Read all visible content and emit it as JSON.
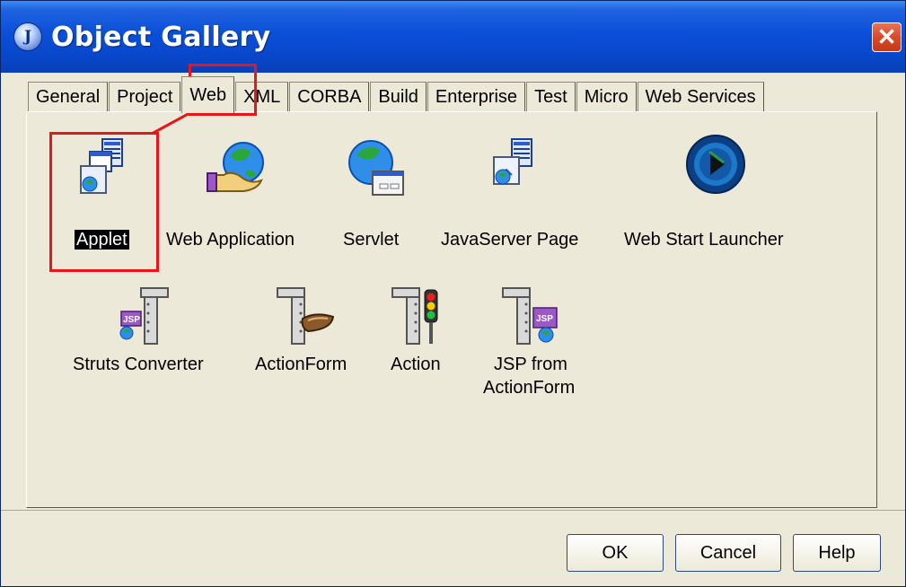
{
  "window": {
    "title": "Object Gallery",
    "title_icon_letter": "J",
    "close_glyph": "✕"
  },
  "tabs": [
    {
      "label": "General"
    },
    {
      "label": "Project"
    },
    {
      "label": "Web"
    },
    {
      "label": "XML"
    },
    {
      "label": "CORBA"
    },
    {
      "label": "Build"
    },
    {
      "label": "Enterprise"
    },
    {
      "label": "Test"
    },
    {
      "label": "Micro"
    },
    {
      "label": "Web Services"
    }
  ],
  "active_tab": "Web",
  "items": [
    {
      "label": "Applet",
      "icon": "applet-icon",
      "selected": true
    },
    {
      "label": "Web Application",
      "icon": "web-application-icon"
    },
    {
      "label": "Servlet",
      "icon": "servlet-icon"
    },
    {
      "label": "JavaServer Page",
      "icon": "javaserver-page-icon"
    },
    {
      "label": "Web Start Launcher",
      "icon": "web-start-launcher-icon"
    },
    {
      "label": "Struts Converter",
      "icon": "struts-converter-icon"
    },
    {
      "label": "ActionForm",
      "icon": "actionform-icon"
    },
    {
      "label": "Action",
      "icon": "action-icon"
    },
    {
      "label": "JSP from",
      "label_line2": "ActionForm",
      "icon": "jsp-from-actionform-icon"
    }
  ],
  "icon_badge": "JSP",
  "buttons": {
    "ok": "OK",
    "cancel": "Cancel",
    "help": "Help"
  },
  "colors": {
    "titlebar": "#0a4fd8",
    "annotation_red": "#e8151b",
    "background": "#ece9d8"
  }
}
